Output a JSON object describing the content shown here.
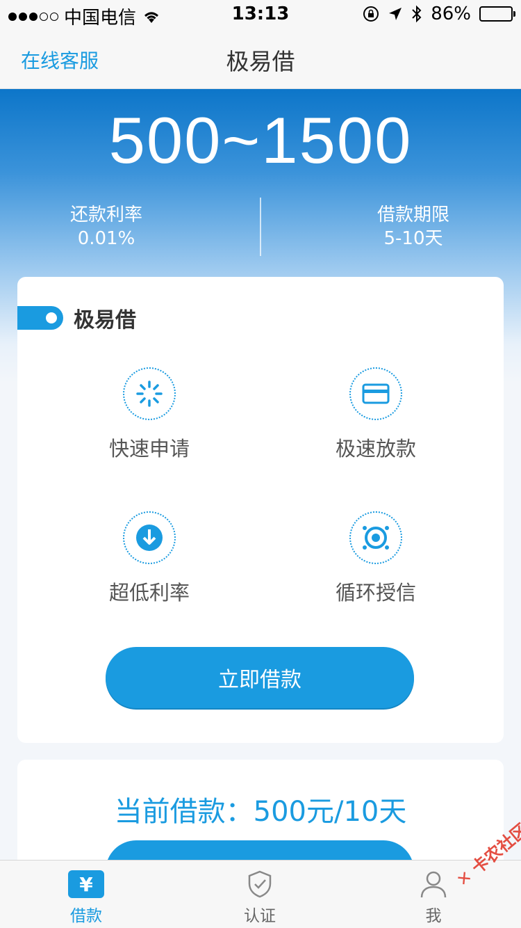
{
  "status_bar": {
    "carrier": "中国电信",
    "time": "13:13",
    "battery": "86%"
  },
  "nav": {
    "left_label": "在线客服",
    "title": "极易借"
  },
  "hero": {
    "amount_range": "500~1500",
    "stats": [
      {
        "label": "还款利率",
        "value": "0.01%"
      },
      {
        "label": "借款期限",
        "value": "5-10天"
      }
    ]
  },
  "card": {
    "title": "极易借",
    "features": [
      {
        "label": "快速申请",
        "icon": "loading-icon"
      },
      {
        "label": "极速放款",
        "icon": "card-icon"
      },
      {
        "label": "超低利率",
        "icon": "down-arrow-icon"
      },
      {
        "label": "循环授信",
        "icon": "cycle-icon"
      }
    ],
    "button_label": "立即借款"
  },
  "current_loan": {
    "text": "当前借款：500元/10天"
  },
  "tabs": [
    {
      "label": "借款",
      "icon": "yen-icon",
      "active": true
    },
    {
      "label": "认证",
      "icon": "shield-check-icon",
      "active": false
    },
    {
      "label": "我",
      "icon": "person-icon",
      "active": false
    }
  ],
  "watermark": "卡农社区",
  "colors": {
    "accent": "#1a9be0",
    "hero_top": "#0062b8"
  }
}
